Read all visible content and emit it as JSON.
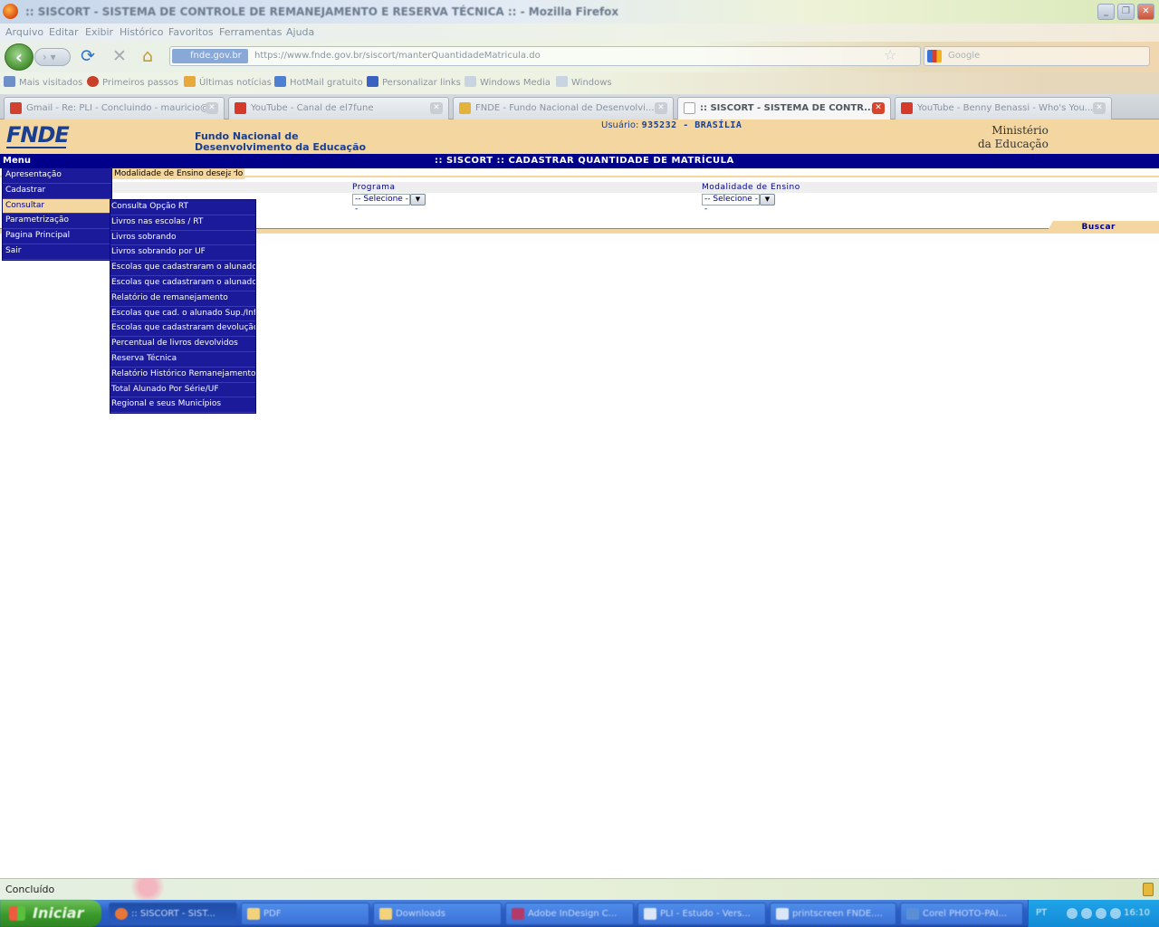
{
  "browser": {
    "window_title": ":: SISCORT - SISTEMA DE CONTROLE DE REMANEJAMENTO E RESERVA TÉCNICA :: - Mozilla Firefox",
    "menu": [
      "Arquivo",
      "Editar",
      "Exibir",
      "Histórico",
      "Favoritos",
      "Ferramentas",
      "Ajuda"
    ],
    "site_identity": "fnde.gov.br",
    "url": "https://www.fnde.gov.br/siscort/manterQuantidadeMatricula.do",
    "search_placeholder": "Google",
    "bookmarks": [
      "Mais visitados",
      "Primeiros passos",
      "Últimas notícias",
      "HotMail gratuito",
      "Personalizar links",
      "Windows Media",
      "Windows"
    ],
    "tabs": [
      {
        "label": "Gmail - Re: PLI - Concluindo - mauricio@...",
        "active": false
      },
      {
        "label": "YouTube - Canal de el7fune",
        "active": false
      },
      {
        "label": "FNDE - Fundo Nacional de Desenvolvi...",
        "active": false
      },
      {
        "label": ":: SISCORT - SISTEMA DE CONTR...",
        "active": true
      },
      {
        "label": "YouTube - Benny Benassi - Who's You...",
        "active": false
      }
    ],
    "status": "Concluído"
  },
  "header": {
    "logo": "FNDE",
    "org_line1": "Fundo Nacional de",
    "org_line2": "Desenvolvimento da Educação",
    "user_label": "Usuário:",
    "user_value": "935232 - BRASÍLIA",
    "ministry_line1": "Ministério",
    "ministry_line2": "da Educação"
  },
  "titlebar": {
    "menu_label": "Menu",
    "page_title": ":: SISCORT :: CADASTRAR QUANTIDADE DE MATRÍCULA"
  },
  "form": {
    "tab_label": "Modalidade de Ensino desejado",
    "programa_label": "Programa",
    "programa_value": "-- Selecione --",
    "modalidade_label": "Modalidade de Ensino",
    "modalidade_value": "-- Selecione --",
    "search_button": "Buscar"
  },
  "main_menu": {
    "items": [
      "Apresentação",
      "Cadastrar",
      "Consultar",
      "Parametrização",
      "Pagina Principal",
      "Sair"
    ],
    "highlighted": "Consultar"
  },
  "sub_menu": {
    "items": [
      "Consulta Opção RT",
      "Livros nas escolas / RT",
      "Livros sobrando",
      "Livros sobrando por UF",
      "Escolas que cadastraram o alunado / UF",
      "Escolas que cadastraram o alunado",
      "Relatório de remanejamento",
      "Escolas que cad. o alunado Sup./Inf.",
      "Escolas que cadastraram devolução",
      "Percentual de livros devolvidos",
      "Reserva Técnica",
      "Relatório Histórico Remanejamento",
      "Total Alunado Por Série/UF",
      "Regional e seus Municípios"
    ]
  },
  "taskbar": {
    "start": "Iniciar",
    "tasks": [
      ":: SISCORT - SIST...",
      "PDF",
      "Downloads",
      "Adobe InDesign C...",
      "PLI - Estudo - Vers...",
      "printscreen FNDE....",
      "Corel PHOTO-PAI..."
    ],
    "language": "PT",
    "clock": "16:10"
  }
}
